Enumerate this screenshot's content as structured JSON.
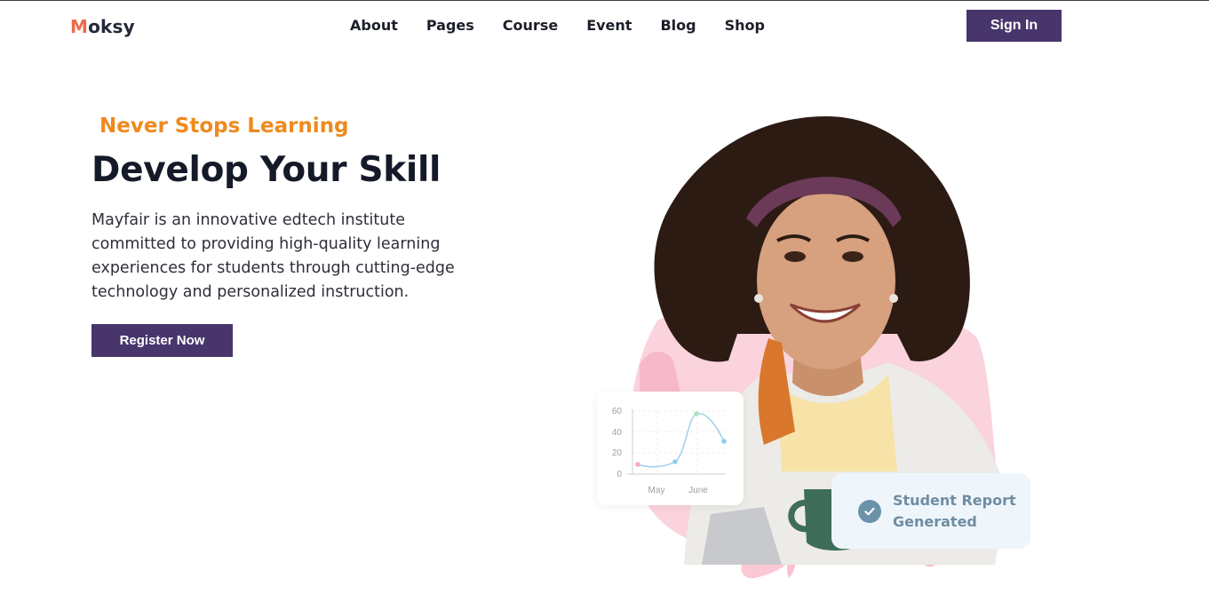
{
  "header": {
    "logo_first": "M",
    "logo_rest": "oksy",
    "nav": [
      "About",
      "Pages",
      "Course",
      "Event",
      "Blog",
      "Shop"
    ],
    "signin_label": "Sign In"
  },
  "hero": {
    "eyebrow": "Never Stops Learning",
    "title": "Develop Your Skill",
    "description": "Mayfair is an innovative edtech institute committed to providing high-quality learning experiences for students through cutting-edge technology and personalized instruction.",
    "cta_label": "Register Now"
  },
  "mini_chart": {
    "y_ticks": [
      "60",
      "40",
      "20",
      "0"
    ],
    "x_ticks": [
      "May",
      "June"
    ]
  },
  "report_card": {
    "text": "Student Report Generated"
  },
  "colors": {
    "brand_purple": "#47356b",
    "accent_orange": "#ee8a1e",
    "logo_accent": "#ef6a4a",
    "blob_pink": "#fbc9d6"
  }
}
